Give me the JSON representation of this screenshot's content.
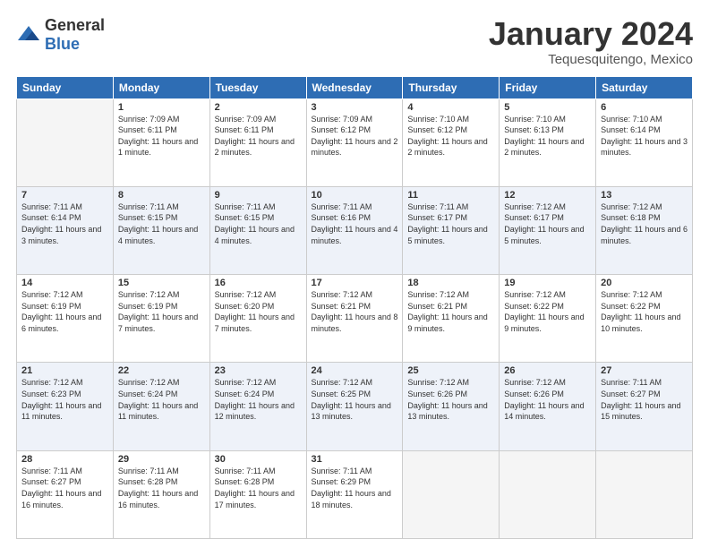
{
  "header": {
    "logo_general": "General",
    "logo_blue": "Blue",
    "title": "January 2024",
    "subtitle": "Tequesquitengo, Mexico"
  },
  "weekdays": [
    "Sunday",
    "Monday",
    "Tuesday",
    "Wednesday",
    "Thursday",
    "Friday",
    "Saturday"
  ],
  "weeks": [
    [
      {
        "day": "",
        "sunrise": "",
        "sunset": "",
        "daylight": "",
        "empty": true
      },
      {
        "day": "1",
        "sunrise": "Sunrise: 7:09 AM",
        "sunset": "Sunset: 6:11 PM",
        "daylight": "Daylight: 11 hours and 1 minute.",
        "empty": false
      },
      {
        "day": "2",
        "sunrise": "Sunrise: 7:09 AM",
        "sunset": "Sunset: 6:11 PM",
        "daylight": "Daylight: 11 hours and 2 minutes.",
        "empty": false
      },
      {
        "day": "3",
        "sunrise": "Sunrise: 7:09 AM",
        "sunset": "Sunset: 6:12 PM",
        "daylight": "Daylight: 11 hours and 2 minutes.",
        "empty": false
      },
      {
        "day": "4",
        "sunrise": "Sunrise: 7:10 AM",
        "sunset": "Sunset: 6:12 PM",
        "daylight": "Daylight: 11 hours and 2 minutes.",
        "empty": false
      },
      {
        "day": "5",
        "sunrise": "Sunrise: 7:10 AM",
        "sunset": "Sunset: 6:13 PM",
        "daylight": "Daylight: 11 hours and 2 minutes.",
        "empty": false
      },
      {
        "day": "6",
        "sunrise": "Sunrise: 7:10 AM",
        "sunset": "Sunset: 6:14 PM",
        "daylight": "Daylight: 11 hours and 3 minutes.",
        "empty": false
      }
    ],
    [
      {
        "day": "7",
        "sunrise": "Sunrise: 7:11 AM",
        "sunset": "Sunset: 6:14 PM",
        "daylight": "Daylight: 11 hours and 3 minutes.",
        "empty": false
      },
      {
        "day": "8",
        "sunrise": "Sunrise: 7:11 AM",
        "sunset": "Sunset: 6:15 PM",
        "daylight": "Daylight: 11 hours and 4 minutes.",
        "empty": false
      },
      {
        "day": "9",
        "sunrise": "Sunrise: 7:11 AM",
        "sunset": "Sunset: 6:15 PM",
        "daylight": "Daylight: 11 hours and 4 minutes.",
        "empty": false
      },
      {
        "day": "10",
        "sunrise": "Sunrise: 7:11 AM",
        "sunset": "Sunset: 6:16 PM",
        "daylight": "Daylight: 11 hours and 4 minutes.",
        "empty": false
      },
      {
        "day": "11",
        "sunrise": "Sunrise: 7:11 AM",
        "sunset": "Sunset: 6:17 PM",
        "daylight": "Daylight: 11 hours and 5 minutes.",
        "empty": false
      },
      {
        "day": "12",
        "sunrise": "Sunrise: 7:12 AM",
        "sunset": "Sunset: 6:17 PM",
        "daylight": "Daylight: 11 hours and 5 minutes.",
        "empty": false
      },
      {
        "day": "13",
        "sunrise": "Sunrise: 7:12 AM",
        "sunset": "Sunset: 6:18 PM",
        "daylight": "Daylight: 11 hours and 6 minutes.",
        "empty": false
      }
    ],
    [
      {
        "day": "14",
        "sunrise": "Sunrise: 7:12 AM",
        "sunset": "Sunset: 6:19 PM",
        "daylight": "Daylight: 11 hours and 6 minutes.",
        "empty": false
      },
      {
        "day": "15",
        "sunrise": "Sunrise: 7:12 AM",
        "sunset": "Sunset: 6:19 PM",
        "daylight": "Daylight: 11 hours and 7 minutes.",
        "empty": false
      },
      {
        "day": "16",
        "sunrise": "Sunrise: 7:12 AM",
        "sunset": "Sunset: 6:20 PM",
        "daylight": "Daylight: 11 hours and 7 minutes.",
        "empty": false
      },
      {
        "day": "17",
        "sunrise": "Sunrise: 7:12 AM",
        "sunset": "Sunset: 6:21 PM",
        "daylight": "Daylight: 11 hours and 8 minutes.",
        "empty": false
      },
      {
        "day": "18",
        "sunrise": "Sunrise: 7:12 AM",
        "sunset": "Sunset: 6:21 PM",
        "daylight": "Daylight: 11 hours and 9 minutes.",
        "empty": false
      },
      {
        "day": "19",
        "sunrise": "Sunrise: 7:12 AM",
        "sunset": "Sunset: 6:22 PM",
        "daylight": "Daylight: 11 hours and 9 minutes.",
        "empty": false
      },
      {
        "day": "20",
        "sunrise": "Sunrise: 7:12 AM",
        "sunset": "Sunset: 6:22 PM",
        "daylight": "Daylight: 11 hours and 10 minutes.",
        "empty": false
      }
    ],
    [
      {
        "day": "21",
        "sunrise": "Sunrise: 7:12 AM",
        "sunset": "Sunset: 6:23 PM",
        "daylight": "Daylight: 11 hours and 11 minutes.",
        "empty": false
      },
      {
        "day": "22",
        "sunrise": "Sunrise: 7:12 AM",
        "sunset": "Sunset: 6:24 PM",
        "daylight": "Daylight: 11 hours and 11 minutes.",
        "empty": false
      },
      {
        "day": "23",
        "sunrise": "Sunrise: 7:12 AM",
        "sunset": "Sunset: 6:24 PM",
        "daylight": "Daylight: 11 hours and 12 minutes.",
        "empty": false
      },
      {
        "day": "24",
        "sunrise": "Sunrise: 7:12 AM",
        "sunset": "Sunset: 6:25 PM",
        "daylight": "Daylight: 11 hours and 13 minutes.",
        "empty": false
      },
      {
        "day": "25",
        "sunrise": "Sunrise: 7:12 AM",
        "sunset": "Sunset: 6:26 PM",
        "daylight": "Daylight: 11 hours and 13 minutes.",
        "empty": false
      },
      {
        "day": "26",
        "sunrise": "Sunrise: 7:12 AM",
        "sunset": "Sunset: 6:26 PM",
        "daylight": "Daylight: 11 hours and 14 minutes.",
        "empty": false
      },
      {
        "day": "27",
        "sunrise": "Sunrise: 7:11 AM",
        "sunset": "Sunset: 6:27 PM",
        "daylight": "Daylight: 11 hours and 15 minutes.",
        "empty": false
      }
    ],
    [
      {
        "day": "28",
        "sunrise": "Sunrise: 7:11 AM",
        "sunset": "Sunset: 6:27 PM",
        "daylight": "Daylight: 11 hours and 16 minutes.",
        "empty": false
      },
      {
        "day": "29",
        "sunrise": "Sunrise: 7:11 AM",
        "sunset": "Sunset: 6:28 PM",
        "daylight": "Daylight: 11 hours and 16 minutes.",
        "empty": false
      },
      {
        "day": "30",
        "sunrise": "Sunrise: 7:11 AM",
        "sunset": "Sunset: 6:28 PM",
        "daylight": "Daylight: 11 hours and 17 minutes.",
        "empty": false
      },
      {
        "day": "31",
        "sunrise": "Sunrise: 7:11 AM",
        "sunset": "Sunset: 6:29 PM",
        "daylight": "Daylight: 11 hours and 18 minutes.",
        "empty": false
      },
      {
        "day": "",
        "sunrise": "",
        "sunset": "",
        "daylight": "",
        "empty": true
      },
      {
        "day": "",
        "sunrise": "",
        "sunset": "",
        "daylight": "",
        "empty": true
      },
      {
        "day": "",
        "sunrise": "",
        "sunset": "",
        "daylight": "",
        "empty": true
      }
    ]
  ]
}
